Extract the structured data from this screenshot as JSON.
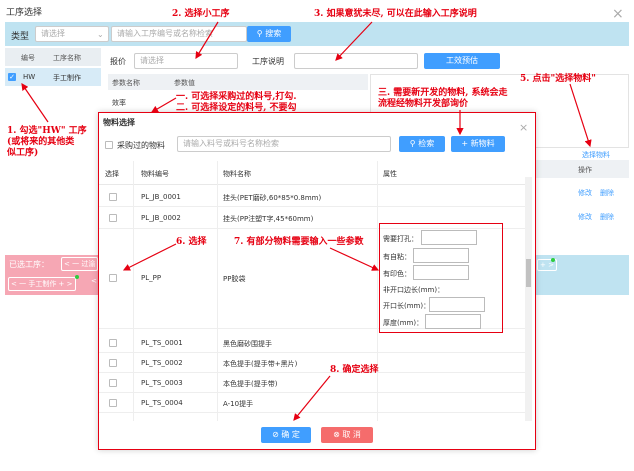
{
  "window_title": "工序选择",
  "close_glyph": "×",
  "toolbar": {
    "type_label": "类型",
    "type_placeholder": "请选择",
    "search_placeholder": "请输入工序编号或名称检索",
    "search_button": "搜索"
  },
  "left_table": {
    "headers": [
      "编号",
      "工序名称"
    ],
    "rows": [
      {
        "code": "HW",
        "name": "手工制作"
      }
    ]
  },
  "quote": {
    "label": "报价",
    "placeholder": "请选择",
    "desc_label": "工序说明",
    "preview_button": "工效预估"
  },
  "params": {
    "headers": [
      "参数名称",
      "参数值"
    ],
    "row": "效率"
  },
  "right_panel": {
    "select_link": "选择物料",
    "col_op": "操作",
    "row_actions": [
      {
        "edit": "修改",
        "delete": "删除"
      },
      {
        "edit": "修改",
        "delete": "删除"
      }
    ]
  },
  "selected": {
    "label": "已选工序：",
    "tag1": "< 一 过渝",
    "tag2": "< 一 手工制作 +  >",
    "tag3": "<",
    "tag_right": "+ >"
  },
  "dialog": {
    "title": "物料选择",
    "purchased_label": "采购过的物料",
    "search_placeholder": "请输入料号或料号名称检索",
    "search_button": "检索",
    "new_button": "新物料",
    "headers": [
      "选择",
      "物料编号",
      "物料名称",
      "属性"
    ],
    "rows": [
      {
        "code": "PL_JB_0001",
        "name": "挂头(PET磨砂,60*85*0.8mm)"
      },
      {
        "code": "PL_JB_0002",
        "name": "挂头(PP注塑T字,45*60mm)"
      },
      {
        "code": "PL_PP",
        "name": "PP胶袋"
      },
      {
        "code": "PL_TS_0001",
        "name": "黑色磨砂围提手"
      },
      {
        "code": "PL_TS_0002",
        "name": "本色提手(提手带+黑片)"
      },
      {
        "code": "PL_TS_0003",
        "name": "本色提手(提手带)"
      },
      {
        "code": "PL_TS_0004",
        "name": "A-10提手"
      }
    ],
    "attributes": [
      "需要打孔：",
      "有自粘：",
      "有印色：",
      "非开口边长(mm)：",
      "开口长(mm)：",
      "厚度(mm)："
    ],
    "confirm_button": "确 定",
    "cancel_button": "取 消"
  },
  "annotations": {
    "n1": "1. 勾选\"HW\" 工序",
    "n1b": "(或将来的其他类",
    "n1c": "似工序)",
    "n2": "2. 选择小工序",
    "n3": "3. 如果意犹未尽, 可以在此输入工序说明",
    "n4a": "一. 可选择采购过的料号,打勾.",
    "n4b": "二. 可选择设定的料号, 不要勾",
    "n4c": "三. 需要新开发的物料, 系统会走",
    "n4d": "流程经物料开发部询价",
    "n5": "5. 点击\"选择物料\"",
    "n6": "6. 选择",
    "n7": "7. 有部分物料需要输入一些参数",
    "n8": "8. 确定选择"
  }
}
